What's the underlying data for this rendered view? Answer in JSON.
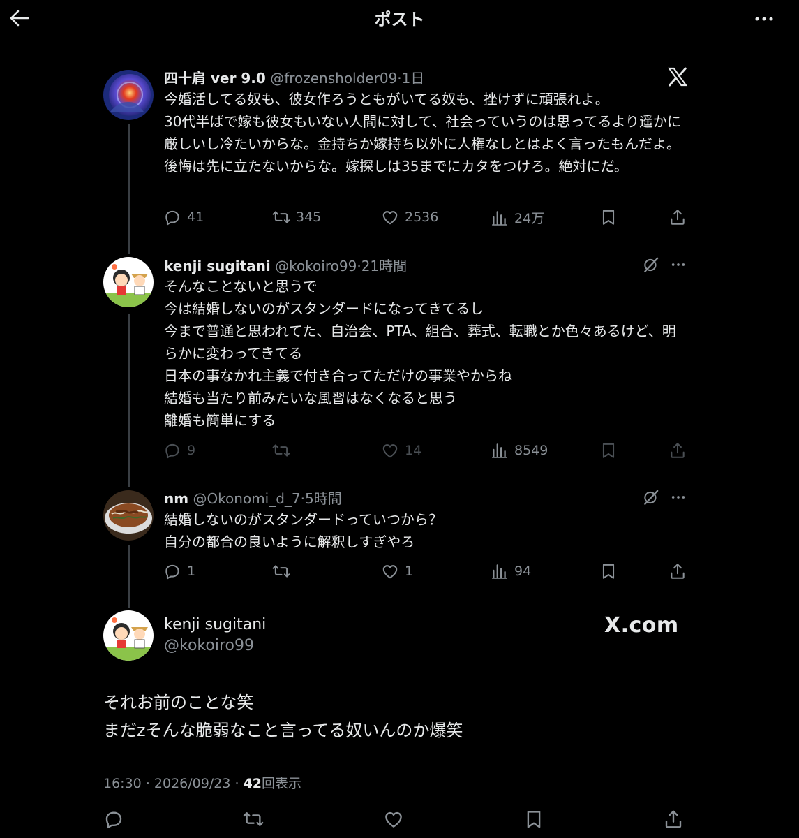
{
  "header": {
    "title": "ポスト"
  },
  "tweets": [
    {
      "name": "四十肩 ver 9.0",
      "handle": "@frozensholder09",
      "sep": "·",
      "time": "1日",
      "text": "今婚活してる奴も、彼女作ろうともがいてる奴も、挫けずに頑張れよ。\n30代半ばで嫁も彼女もいない人間に対して、社会っていうのは思ってるより遥かに厳しいし冷たいからな。金持ちか嫁持ち以外に人権なしとはよく言ったもんだよ。後悔は先に立たないからな。嫁探しは35までにカタをつけろ。絶対にだ。",
      "replies": "41",
      "retweets": "345",
      "likes": "2536",
      "views": "24万"
    },
    {
      "name": "kenji sugitani",
      "handle": "@kokoiro99",
      "sep": "·",
      "time": "21時間",
      "text": "そんなことないと思うで\n今は結婚しないのがスタンダードになってきてるし\n今まで普通と思われてた、自治会、PTA、組合、葬式、転職とか色々あるけど、明らかに変わってきてる\n日本の事なかれ主義で付き合ってただけの事業やからね\n結婚も当たり前みたいな風習はなくなると思う\n離婚も簡単にする",
      "replies": "9",
      "retweets": "",
      "likes": "14",
      "views": "8549"
    },
    {
      "name": "nm",
      "handle": "@Okonomi_d_7",
      "sep": "·",
      "time": "5時間",
      "text": "結婚しないのがスタンダードっていつから？\n自分の都合の良いように解釈しすぎやろ",
      "replies": "1",
      "retweets": "",
      "likes": "1",
      "views": "94"
    }
  ],
  "main": {
    "name": "kenji sugitani",
    "handle": "@kokoiro99",
    "watermark": "X.com",
    "text": "それお前のことな笑\nまだzそんな脆弱なこと言ってる奴いんのか爆笑",
    "time": "16:30",
    "sep1": "·",
    "date": "2026/09/23",
    "sep2": "·",
    "views_count": "42",
    "views_label": "回表示"
  },
  "icons": {
    "back": "arrow-left-icon",
    "more": "more-horizontal-icon",
    "x_logo": "x-logo-icon",
    "grok": "grok-slash-icon",
    "reply": "comment-icon",
    "retweet": "retweet-icon",
    "like": "heart-icon",
    "views": "bar-chart-icon",
    "bookmark": "bookmark-icon",
    "share": "share-upload-icon"
  },
  "colors": {
    "background": "#000000",
    "text": "#e7e9ea",
    "muted": "#8b9197",
    "dim": "#4a4f54",
    "thread_line": "#3a3f44"
  }
}
